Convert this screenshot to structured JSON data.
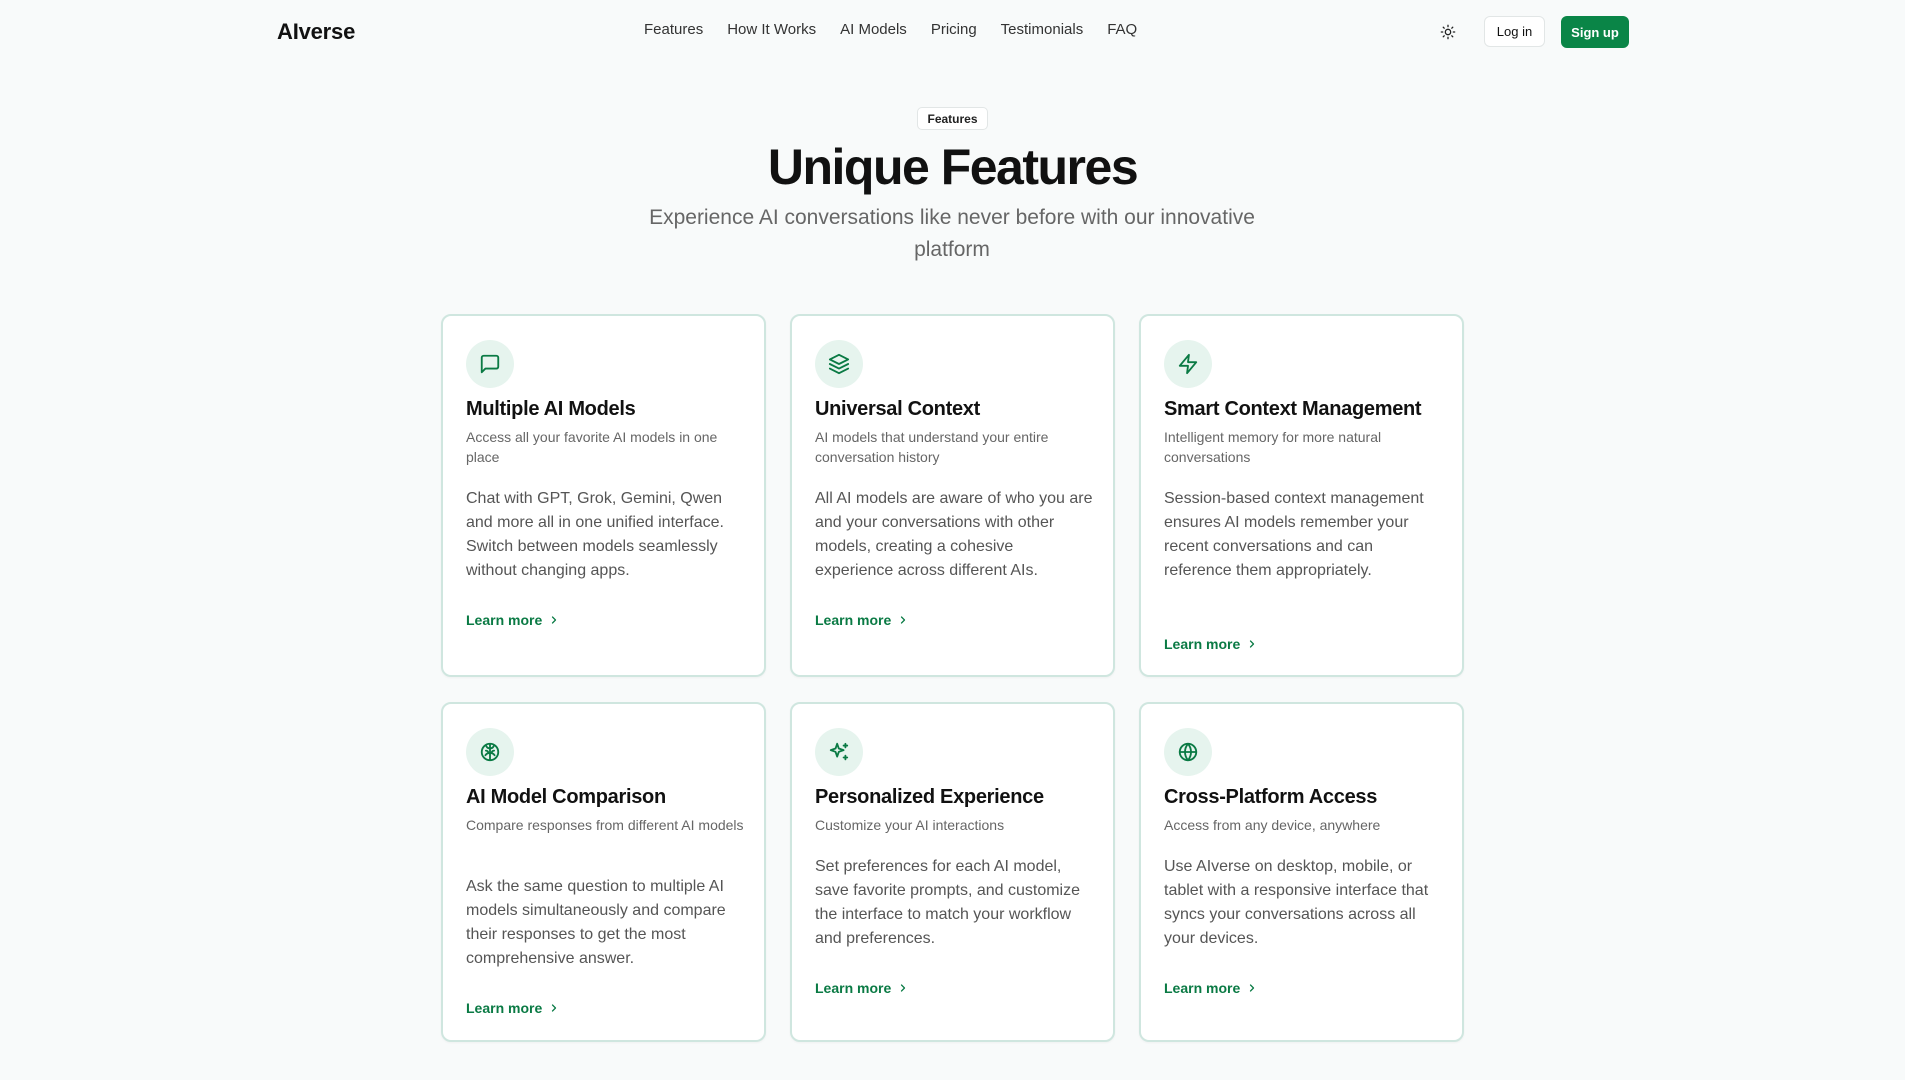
{
  "nav": {
    "brand": "AIverse",
    "links": [
      "Features",
      "How It Works",
      "AI Models",
      "Pricing",
      "Testimonials",
      "FAQ"
    ],
    "theme_icon": "sun-icon",
    "login": "Log in",
    "signup": "Sign up"
  },
  "section": {
    "badge": "Features",
    "title": "Unique Features",
    "subtitle": "Experience AI conversations like never before with our innovative platform"
  },
  "colors": {
    "accent": "#0a8547",
    "icon_bg": "#e6f4ee",
    "card_border": "#cfe6df"
  },
  "cards": [
    {
      "icon": "message-square-icon",
      "title": "Multiple AI Models",
      "subtitle": "Access all your favorite AI models in one place",
      "description": "Chat with GPT, Grok, Gemini, Qwen and more all in one unified interface. Switch between models seamlessly without changing apps.",
      "link": "Learn more"
    },
    {
      "icon": "layers-icon",
      "title": "Universal Context",
      "subtitle": "AI models that understand your entire conversation history",
      "description": "All AI models are aware of who you are and your conversations with other models, creating a cohesive experience across different AIs.",
      "link": "Learn more"
    },
    {
      "icon": "zap-icon",
      "title": "Smart Context Management",
      "subtitle": "Intelligent memory for more natural conversations",
      "description": "Session-based context management ensures AI models remember your recent conversations and can reference them appropriately.",
      "link": "Learn more"
    },
    {
      "icon": "brain-icon",
      "title": "AI Model Comparison",
      "subtitle": "Compare responses from different AI models",
      "description": "Ask the same question to multiple AI models simultaneously and compare their responses to get the most comprehensive answer.",
      "link": "Learn more"
    },
    {
      "icon": "sparkles-icon",
      "title": "Personalized Experience",
      "subtitle": "Customize your AI interactions",
      "description": "Set preferences for each AI model, save favorite prompts, and customize the interface to match your workflow and preferences.",
      "link": "Learn more"
    },
    {
      "icon": "globe-icon",
      "title": "Cross-Platform Access",
      "subtitle": "Access from any device, anywhere",
      "description": "Use AIverse on desktop, mobile, or tablet with a responsive interface that syncs your conversations across all your devices.",
      "link": "Learn more"
    }
  ]
}
